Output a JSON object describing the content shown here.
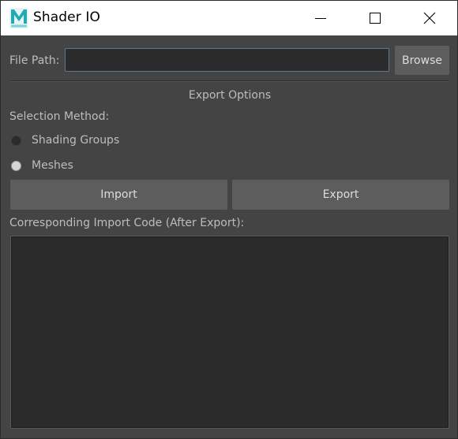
{
  "window": {
    "title": "Shader IO",
    "app_icon": "maya-icon",
    "controls": [
      "minimize-icon",
      "maximize-icon",
      "close-icon"
    ]
  },
  "file_path": {
    "label": "File Path:",
    "value": "",
    "browse_label": "Browse"
  },
  "export_options": {
    "title": "Export Options",
    "selection_method_label": "Selection Method:",
    "options": [
      {
        "label": "Shading Groups",
        "selected": false
      },
      {
        "label": "Meshes",
        "selected": true
      }
    ]
  },
  "actions": {
    "import_label": "Import",
    "export_label": "Export"
  },
  "code": {
    "label": "Corresponding Import Code (After Export):",
    "value": ""
  },
  "colors": {
    "background": "#444444",
    "button": "#5d5d5d",
    "field": "#2b2b2b",
    "focus_border": "#5e7a8e",
    "icon_teal": "#26a8b5"
  }
}
